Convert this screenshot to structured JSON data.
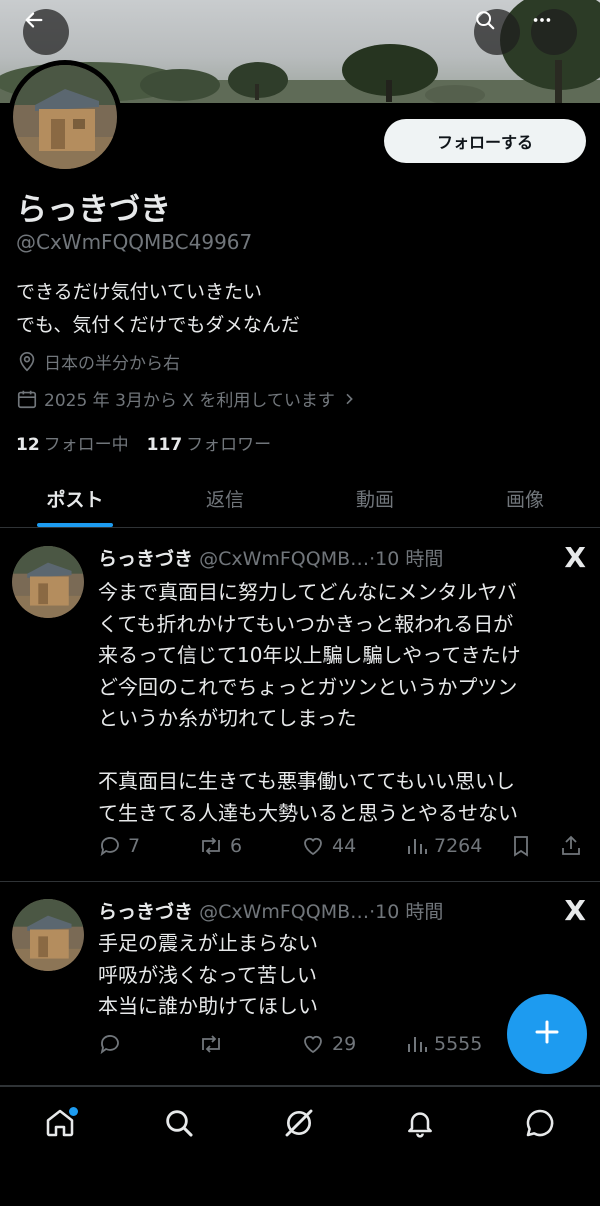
{
  "header": {
    "back_icon": "arrow-left-icon",
    "search_icon": "search-icon",
    "more_icon": "more-horizontal-icon"
  },
  "profile": {
    "display_name": "らっきづき",
    "handle": "@CxWmFQQMBC49967",
    "follow_label": "フォローする",
    "bio_line1": "できるだけ気付いていきたい",
    "bio_line2": "でも、気付くだけでもダメなんだ",
    "location": "日本の半分から右",
    "joined": "2025 年 3月から X を利用しています",
    "following_count": "12",
    "following_label": "フォロー中",
    "followers_count": "117",
    "followers_label": "フォロワー"
  },
  "tabs": [
    {
      "label": "ポスト",
      "active": true
    },
    {
      "label": "返信",
      "active": false
    },
    {
      "label": "動画",
      "active": false
    },
    {
      "label": "画像",
      "active": false
    }
  ],
  "posts": [
    {
      "name": "らっきづき",
      "handle": "@CxWmFQQMB…",
      "time": "·10 時間",
      "text_lines": [
        "今まで真面目に努力してどんなにメンタルヤバ",
        "くても折れかけてもいつかきっと報われる日が",
        "来るって信じて10年以上騙し騙しやってきたけ",
        "ど今回のこれでちょっとガツンというかプツン",
        "というか糸が切れてしまった",
        "",
        "不真面目に生きても悪事働いててもいい思いし",
        "て生きてる人達も大勢いると思うとやるせない"
      ],
      "replies": "7",
      "reposts": "6",
      "likes": "44",
      "views": "7264"
    },
    {
      "name": "らっきづき",
      "handle": "@CxWmFQQMB…",
      "time": "·10 時間",
      "text_lines": [
        "手足の震えが止まらない",
        "呼吸が浅くなって苦しい",
        "本当に誰か助けてほしい"
      ],
      "replies": "",
      "reposts": "",
      "likes": "29",
      "views": "5555"
    }
  ],
  "x_logo": "X",
  "fab_label": "+",
  "bottom_nav": [
    "home-icon",
    "search-icon",
    "grok-icon",
    "notifications-icon",
    "messages-icon"
  ],
  "colors": {
    "accent": "#1d9bf0",
    "background": "#000000",
    "muted": "#71767b",
    "text": "#e7e9ea"
  }
}
